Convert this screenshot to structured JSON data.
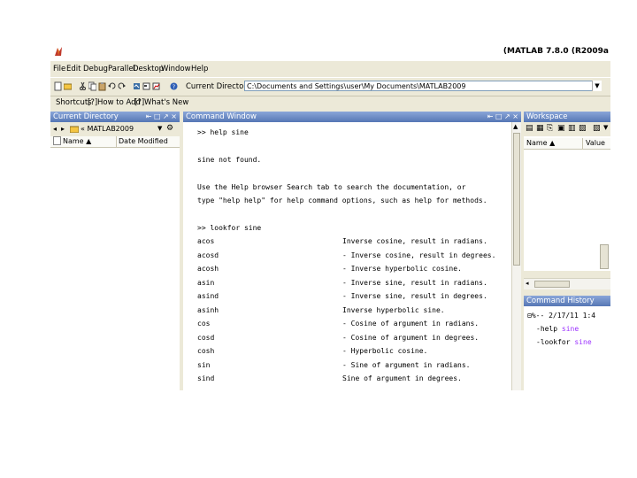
{
  "window": {
    "title": "(MATLAB 7.8.0 (R2009a"
  },
  "menu": [
    "File",
    "Edit",
    "Debug",
    "Parallel",
    "Desktop",
    "Window",
    "Help"
  ],
  "toolbar": {
    "current_directory_label": "Current Directory",
    "current_directory_value": "C:\\Documents and Settings\\user\\My Documents\\MATLAB2009"
  },
  "shortcuts": {
    "shortcuts_label": "Shortcuts",
    "how_to_add_label": "How to Add",
    "whats_new_label": "What's New"
  },
  "current_directory_pane": {
    "title": "Current Directory",
    "path": "« MATLAB2009",
    "columns": [
      "Name ▲",
      "Date Modified"
    ]
  },
  "command_window": {
    "title": "Command Window",
    "lines": [
      ">> help sine",
      "sine not found.",
      "Use the Help browser Search tab to search the documentation, or",
      "type \"help help\" for help command options, such as help for methods."
    ],
    "lookfor_command": ">> lookfor sine",
    "lookfor_results": [
      {
        "name": "acos",
        "desc": "Inverse cosine, result in radians."
      },
      {
        "name": "acosd",
        "desc": "- Inverse cosine, result in degrees."
      },
      {
        "name": "acosh",
        "desc": "- Inverse hyperbolic cosine."
      },
      {
        "name": "asin",
        "desc": "- Inverse sine, result in radians."
      },
      {
        "name": "asind",
        "desc": "- Inverse sine, result in degrees."
      },
      {
        "name": "asinh",
        "desc": "Inverse hyperbolic sine."
      },
      {
        "name": "cos",
        "desc": "- Cosine of argument in radians."
      },
      {
        "name": "cosd",
        "desc": "- Cosine of argument in degrees."
      },
      {
        "name": "cosh",
        "desc": "- Hyperbolic cosine."
      },
      {
        "name": "sin",
        "desc": "- Sine of argument in radians."
      },
      {
        "name": "sind",
        "desc": "Sine of argument in degrees."
      }
    ]
  },
  "workspace": {
    "title": "Workspace",
    "columns": [
      "Name ▲",
      "Value"
    ]
  },
  "command_history": {
    "title": "Command History",
    "session": "%-- 2/17/11  1:4",
    "entries": [
      {
        "cmd": "help",
        "arg": " sine"
      },
      {
        "cmd": "lookfor",
        "arg": " sine"
      }
    ]
  },
  "colors": {
    "pane_header": "#5677b5",
    "history_keyword": "#9b30ff",
    "window_bg": "#ece9d8"
  }
}
